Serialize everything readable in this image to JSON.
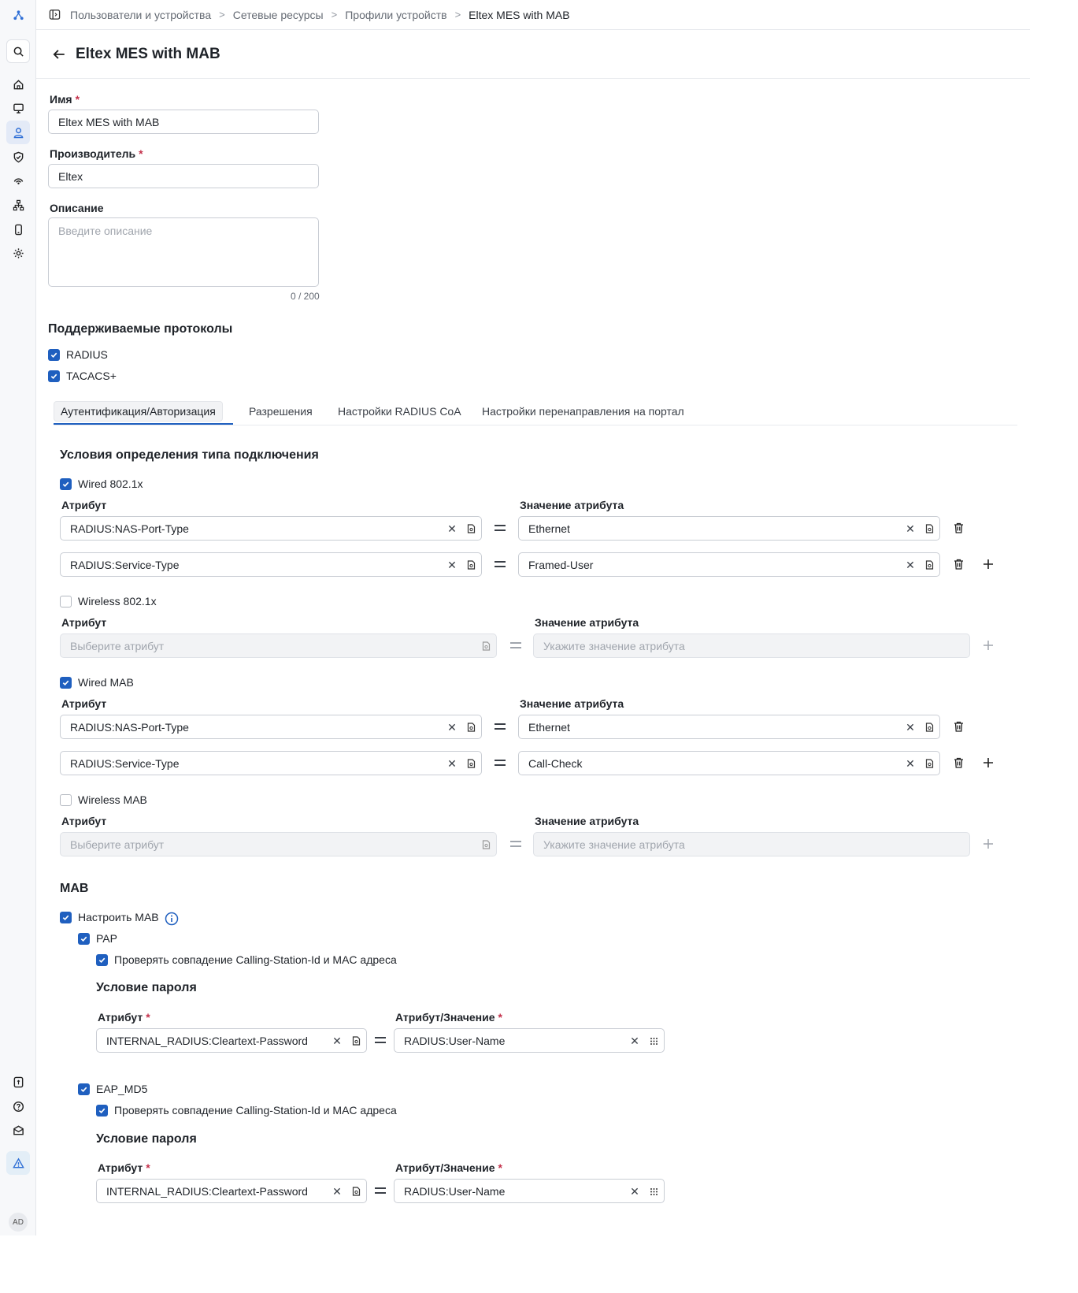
{
  "breadcrumb": [
    "Пользователи и устройства",
    "Сетевые ресурсы",
    "Профили устройств",
    "Eltex MES with MAB"
  ],
  "title": "Eltex MES with MAB",
  "form": {
    "name_label": "Имя",
    "name_value": "Eltex MES with MAB",
    "vendor_label": "Производитель",
    "vendor_value": "Eltex",
    "desc_label": "Описание",
    "desc_placeholder": "Введите описание",
    "desc_counter": "0 / 200"
  },
  "protocols": {
    "title": "Поддерживаемые протоколы",
    "radius": "RADIUS",
    "tacacs": "TACACS+"
  },
  "tabs": [
    "Аутентификация/Авторизация",
    "Разрешения",
    "Настройки RADIUS CoA",
    "Настройки перенаправления на портал"
  ],
  "conditions": {
    "title": "Условия определения типа подключения",
    "attr_label": "Атрибут",
    "value_label": "Значение атрибута",
    "attr_placeholder": "Выберите атрибут",
    "value_placeholder": "Укажите значение атрибута",
    "wired_dot1x": {
      "label": "Wired 802.1x",
      "checked": true,
      "rows": [
        {
          "attr": "RADIUS:NAS-Port-Type",
          "value": "Ethernet"
        },
        {
          "attr": "RADIUS:Service-Type",
          "value": "Framed-User"
        }
      ]
    },
    "wireless_dot1x": {
      "label": "Wireless 802.1x",
      "checked": false
    },
    "wired_mab": {
      "label": "Wired MAB",
      "checked": true,
      "rows": [
        {
          "attr": "RADIUS:NAS-Port-Type",
          "value": "Ethernet"
        },
        {
          "attr": "RADIUS:Service-Type",
          "value": "Call-Check"
        }
      ]
    },
    "wireless_mab": {
      "label": "Wireless MAB",
      "checked": false
    }
  },
  "mab": {
    "title": "MAB",
    "configure": "Настроить MAB",
    "pap": {
      "label": "PAP",
      "check": "Проверять совпадение Calling-Station-Id и MAC адреса",
      "pw_title": "Условие пароля",
      "attr_label": "Атрибут",
      "value_label": "Атрибут/Значение",
      "attr": "INTERNAL_RADIUS:Cleartext-Password",
      "value": "RADIUS:User-Name"
    },
    "eap": {
      "label": "EAP_MD5",
      "check": "Проверять совпадение Calling-Station-Id и MAC адреса",
      "pw_title": "Условие пароля",
      "attr_label": "Атрибут",
      "value_label": "Атрибут/Значение",
      "attr": "INTERNAL_RADIUS:Cleartext-Password",
      "value": "RADIUS:User-Name"
    }
  },
  "user": {
    "initials": "AD"
  },
  "colors": {
    "accent": "#1f5fbf",
    "required": "#c4314b"
  }
}
